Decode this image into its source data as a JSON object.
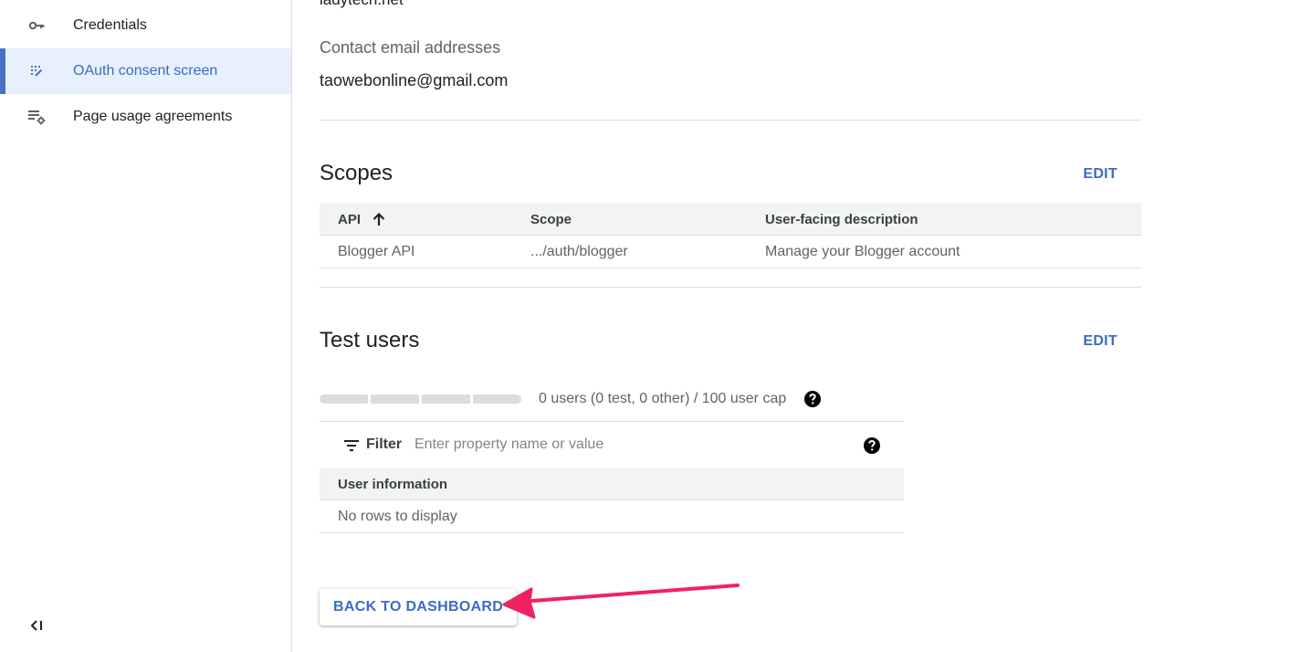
{
  "sidebar": {
    "items": [
      {
        "label": "Credentials",
        "icon": "key-icon",
        "active": false
      },
      {
        "label": "OAuth consent screen",
        "icon": "oauth-grid-icon",
        "active": true
      },
      {
        "label": "Page usage agreements",
        "icon": "settings-list-icon",
        "active": false
      }
    ],
    "collapse_icon": "collapse-sidebar-icon"
  },
  "main": {
    "cut_text": "ladytech.net",
    "contact_label": "Contact email addresses",
    "contact_value": "taowebonline@gmail.com"
  },
  "scopes": {
    "title": "Scopes",
    "edit_label": "EDIT",
    "columns": [
      "API",
      "Scope",
      "User-facing description"
    ],
    "sort_icon": "arrow-up-icon",
    "rows": [
      [
        "Blogger API",
        ".../auth/blogger",
        "Manage your Blogger account"
      ]
    ]
  },
  "test_users": {
    "title": "Test users",
    "edit_label": "EDIT",
    "cap_text": "0 users (0 test, 0 other) / 100 user cap",
    "usage_fraction": 0,
    "filter_label": "Filter",
    "filter_placeholder": "Enter property name or value",
    "filter_value": "",
    "column": "User information",
    "empty_text": "No rows to display"
  },
  "footer": {
    "back_label": "BACK TO DASHBOARD"
  },
  "colors": {
    "accent": "#3c6bc4",
    "active_bg": "#e8f0fe",
    "annotation_arrow": "#f0215f"
  }
}
